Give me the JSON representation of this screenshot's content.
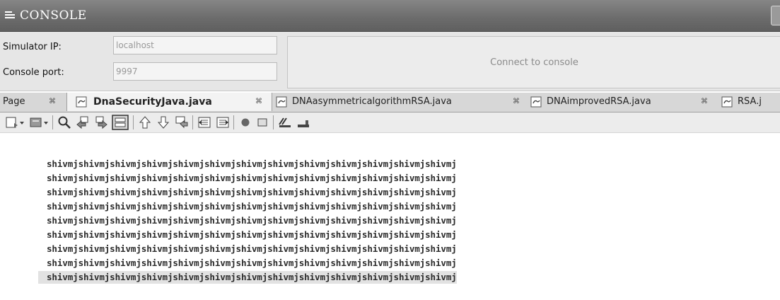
{
  "console": {
    "title": "CONSOLE",
    "simulator_ip_label": "Simulator IP:",
    "simulator_ip_value": "localhost",
    "console_port_label": "Console port:",
    "console_port_value": "9997",
    "connect_button": "Connect to console"
  },
  "tabs": [
    {
      "label": "Page",
      "active": false
    },
    {
      "label": "DnaSecurityJava.java",
      "active": true
    },
    {
      "label": "DNAasymmetricalgorithmRSA.java",
      "active": false
    },
    {
      "label": "DNAimprovedRSA.java",
      "active": false
    },
    {
      "label": "RSA.j",
      "active": false
    }
  ],
  "tab_close_glyph": "⌘",
  "toolbar_icons": [
    "new-file-icon",
    "dropdown-arrow-icon",
    "open-icon",
    "dropdown-arrow-icon",
    "search-icon",
    "find-previous-icon",
    "find-next-icon",
    "toggle-highlight-icon",
    "previous-bookmark-icon",
    "next-bookmark-icon",
    "toggle-bookmark-icon",
    "shift-left-icon",
    "shift-right-icon",
    "record-macro-icon",
    "stop-macro-icon",
    "comment-icon",
    "uncomment-icon"
  ],
  "editor": {
    "lines": [
      "shivmjshivmjshivmjshivmjshivmjshivmjshivmjshivmjshivmjshivmjshivmjshivmjshivmj",
      "shivmjshivmjshivmjshivmjshivmjshivmjshivmjshivmjshivmjshivmjshivmjshivmjshivmj",
      "shivmjshivmjshivmjshivmjshivmjshivmjshivmjshivmjshivmjshivmjshivmjshivmjshivmj",
      "shivmjshivmjshivmjshivmjshivmjshivmjshivmjshivmjshivmjshivmjshivmjshivmjshivmj",
      "shivmjshivmjshivmjshivmjshivmjshivmjshivmjshivmjshivmjshivmjshivmjshivmjshivmj",
      "shivmjshivmjshivmjshivmjshivmjshivmjshivmjshivmjshivmjshivmjshivmjshivmjshivmj",
      "shivmjshivmjshivmjshivmjshivmjshivmjshivmjshivmjshivmjshivmjshivmjshivmjshivmj",
      "shivmjshivmjshivmjshivmjshivmjshivmjshivmjshivmjshivmjshivmjshivmjshivmjshivmj",
      "shivmjshivmjshivmjshivmjshivmjshivmjshivmjshivmjshivmjshivmjshivmjshivmjshivmj"
    ]
  }
}
